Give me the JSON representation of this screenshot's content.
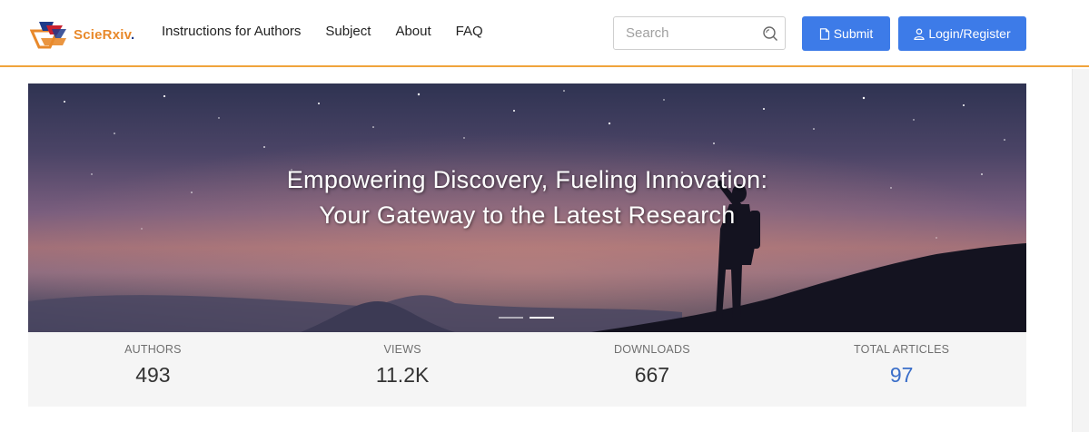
{
  "brand": {
    "name": "ScieRxiv",
    "suffix": ".",
    "colors": {
      "orange": "#e8892b",
      "navy": "#1e3a8a",
      "red": "#c8202f"
    }
  },
  "nav": {
    "items": [
      {
        "label": "Instructions for Authors"
      },
      {
        "label": "Subject"
      },
      {
        "label": "About"
      },
      {
        "label": "FAQ"
      }
    ]
  },
  "search": {
    "placeholder": "Search",
    "value": "",
    "icon": "search-icon"
  },
  "buttons": {
    "submit_label": "Submit",
    "submit_icon": "document-icon",
    "login_label": "Login/Register",
    "login_icon": "user-icon",
    "color": "#3d7be8"
  },
  "hero": {
    "title_line1": "Empowering Discovery, Fueling Innovation:",
    "title_line2": "Your Gateway to the Latest Research",
    "slide_count": 2,
    "active_slide": 2
  },
  "stats": [
    {
      "label": "AUTHORS",
      "value": "493"
    },
    {
      "label": "VIEWS",
      "value": "11.2K"
    },
    {
      "label": "DOWNLOADS",
      "value": "667"
    },
    {
      "label": "TOTAL ARTICLES",
      "value": "97",
      "accent": true
    }
  ],
  "colors": {
    "header_border": "#f0a43c",
    "accent_blue": "#3a6ec9"
  }
}
